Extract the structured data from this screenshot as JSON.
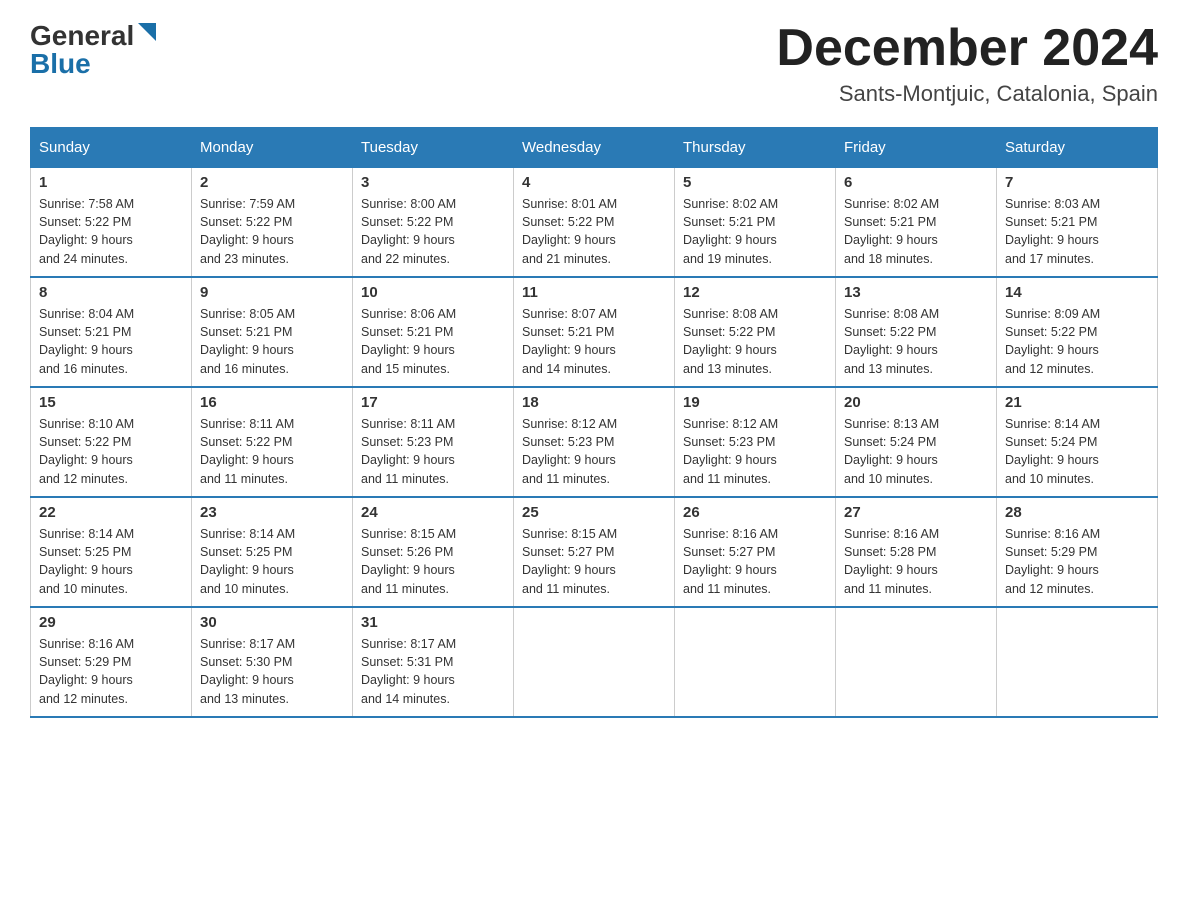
{
  "header": {
    "logo_general": "General",
    "logo_blue": "Blue",
    "month_title": "December 2024",
    "location": "Sants-Montjuic, Catalonia, Spain"
  },
  "days_of_week": [
    "Sunday",
    "Monday",
    "Tuesday",
    "Wednesday",
    "Thursday",
    "Friday",
    "Saturday"
  ],
  "weeks": [
    [
      {
        "day": "1",
        "info": "Sunrise: 7:58 AM\nSunset: 5:22 PM\nDaylight: 9 hours\nand 24 minutes."
      },
      {
        "day": "2",
        "info": "Sunrise: 7:59 AM\nSunset: 5:22 PM\nDaylight: 9 hours\nand 23 minutes."
      },
      {
        "day": "3",
        "info": "Sunrise: 8:00 AM\nSunset: 5:22 PM\nDaylight: 9 hours\nand 22 minutes."
      },
      {
        "day": "4",
        "info": "Sunrise: 8:01 AM\nSunset: 5:22 PM\nDaylight: 9 hours\nand 21 minutes."
      },
      {
        "day": "5",
        "info": "Sunrise: 8:02 AM\nSunset: 5:21 PM\nDaylight: 9 hours\nand 19 minutes."
      },
      {
        "day": "6",
        "info": "Sunrise: 8:02 AM\nSunset: 5:21 PM\nDaylight: 9 hours\nand 18 minutes."
      },
      {
        "day": "7",
        "info": "Sunrise: 8:03 AM\nSunset: 5:21 PM\nDaylight: 9 hours\nand 17 minutes."
      }
    ],
    [
      {
        "day": "8",
        "info": "Sunrise: 8:04 AM\nSunset: 5:21 PM\nDaylight: 9 hours\nand 16 minutes."
      },
      {
        "day": "9",
        "info": "Sunrise: 8:05 AM\nSunset: 5:21 PM\nDaylight: 9 hours\nand 16 minutes."
      },
      {
        "day": "10",
        "info": "Sunrise: 8:06 AM\nSunset: 5:21 PM\nDaylight: 9 hours\nand 15 minutes."
      },
      {
        "day": "11",
        "info": "Sunrise: 8:07 AM\nSunset: 5:21 PM\nDaylight: 9 hours\nand 14 minutes."
      },
      {
        "day": "12",
        "info": "Sunrise: 8:08 AM\nSunset: 5:22 PM\nDaylight: 9 hours\nand 13 minutes."
      },
      {
        "day": "13",
        "info": "Sunrise: 8:08 AM\nSunset: 5:22 PM\nDaylight: 9 hours\nand 13 minutes."
      },
      {
        "day": "14",
        "info": "Sunrise: 8:09 AM\nSunset: 5:22 PM\nDaylight: 9 hours\nand 12 minutes."
      }
    ],
    [
      {
        "day": "15",
        "info": "Sunrise: 8:10 AM\nSunset: 5:22 PM\nDaylight: 9 hours\nand 12 minutes."
      },
      {
        "day": "16",
        "info": "Sunrise: 8:11 AM\nSunset: 5:22 PM\nDaylight: 9 hours\nand 11 minutes."
      },
      {
        "day": "17",
        "info": "Sunrise: 8:11 AM\nSunset: 5:23 PM\nDaylight: 9 hours\nand 11 minutes."
      },
      {
        "day": "18",
        "info": "Sunrise: 8:12 AM\nSunset: 5:23 PM\nDaylight: 9 hours\nand 11 minutes."
      },
      {
        "day": "19",
        "info": "Sunrise: 8:12 AM\nSunset: 5:23 PM\nDaylight: 9 hours\nand 11 minutes."
      },
      {
        "day": "20",
        "info": "Sunrise: 8:13 AM\nSunset: 5:24 PM\nDaylight: 9 hours\nand 10 minutes."
      },
      {
        "day": "21",
        "info": "Sunrise: 8:14 AM\nSunset: 5:24 PM\nDaylight: 9 hours\nand 10 minutes."
      }
    ],
    [
      {
        "day": "22",
        "info": "Sunrise: 8:14 AM\nSunset: 5:25 PM\nDaylight: 9 hours\nand 10 minutes."
      },
      {
        "day": "23",
        "info": "Sunrise: 8:14 AM\nSunset: 5:25 PM\nDaylight: 9 hours\nand 10 minutes."
      },
      {
        "day": "24",
        "info": "Sunrise: 8:15 AM\nSunset: 5:26 PM\nDaylight: 9 hours\nand 11 minutes."
      },
      {
        "day": "25",
        "info": "Sunrise: 8:15 AM\nSunset: 5:27 PM\nDaylight: 9 hours\nand 11 minutes."
      },
      {
        "day": "26",
        "info": "Sunrise: 8:16 AM\nSunset: 5:27 PM\nDaylight: 9 hours\nand 11 minutes."
      },
      {
        "day": "27",
        "info": "Sunrise: 8:16 AM\nSunset: 5:28 PM\nDaylight: 9 hours\nand 11 minutes."
      },
      {
        "day": "28",
        "info": "Sunrise: 8:16 AM\nSunset: 5:29 PM\nDaylight: 9 hours\nand 12 minutes."
      }
    ],
    [
      {
        "day": "29",
        "info": "Sunrise: 8:16 AM\nSunset: 5:29 PM\nDaylight: 9 hours\nand 12 minutes."
      },
      {
        "day": "30",
        "info": "Sunrise: 8:17 AM\nSunset: 5:30 PM\nDaylight: 9 hours\nand 13 minutes."
      },
      {
        "day": "31",
        "info": "Sunrise: 8:17 AM\nSunset: 5:31 PM\nDaylight: 9 hours\nand 14 minutes."
      },
      {
        "day": "",
        "info": ""
      },
      {
        "day": "",
        "info": ""
      },
      {
        "day": "",
        "info": ""
      },
      {
        "day": "",
        "info": ""
      }
    ]
  ]
}
